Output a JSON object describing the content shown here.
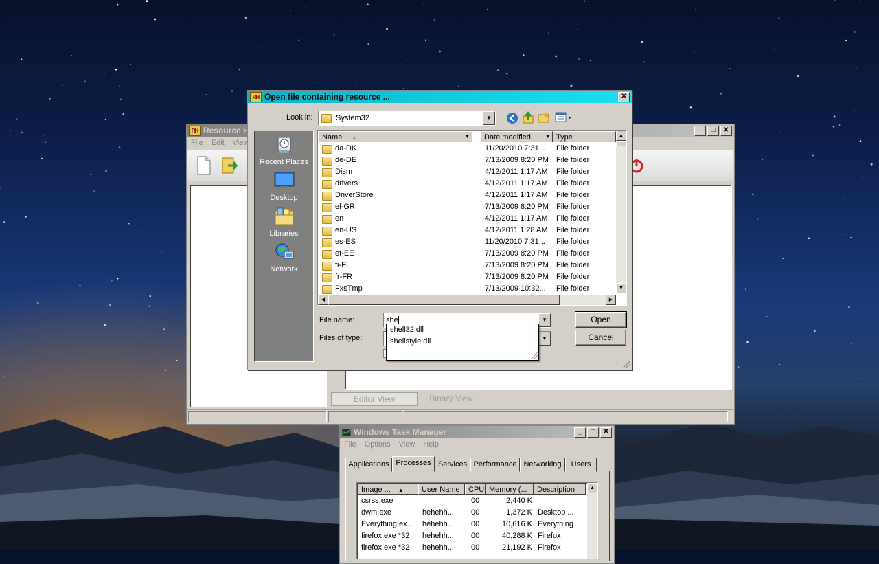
{
  "colors": {
    "accent_title": "#19e0f0",
    "folder": "#e4b93e",
    "inactive_title": "#a0a0a0"
  },
  "resource_hacker": {
    "title": "Resource H",
    "menu": [
      "File",
      "Edit",
      "View"
    ],
    "tabs": {
      "editor": "Editor View",
      "binary": "Binary View"
    }
  },
  "dialog": {
    "title": "Open file containing resource ...",
    "look_in_label": "Look in:",
    "look_in_value": "System32",
    "places": [
      {
        "label": "Recent Places",
        "icon": "recent-places-icon"
      },
      {
        "label": "Desktop",
        "icon": "desktop-icon"
      },
      {
        "label": "Libraries",
        "icon": "libraries-icon"
      },
      {
        "label": "Network",
        "icon": "network-icon"
      }
    ],
    "columns": {
      "name": "Name",
      "date": "Date modified",
      "type": "Type"
    },
    "files": [
      {
        "name": "da-DK",
        "date": "11/20/2010 7:31...",
        "type": "File folder"
      },
      {
        "name": "de-DE",
        "date": "7/13/2009 8:20 PM",
        "type": "File folder"
      },
      {
        "name": "Dism",
        "date": "4/12/2011 1:17 AM",
        "type": "File folder"
      },
      {
        "name": "drivers",
        "date": "4/12/2011 1:17 AM",
        "type": "File folder"
      },
      {
        "name": "DriverStore",
        "date": "4/12/2011 1:17 AM",
        "type": "File folder"
      },
      {
        "name": "el-GR",
        "date": "7/13/2009 8:20 PM",
        "type": "File folder"
      },
      {
        "name": "en",
        "date": "4/12/2011 1:17 AM",
        "type": "File folder"
      },
      {
        "name": "en-US",
        "date": "4/12/2011 1:28 AM",
        "type": "File folder"
      },
      {
        "name": "es-ES",
        "date": "11/20/2010 7:31...",
        "type": "File folder"
      },
      {
        "name": "et-EE",
        "date": "7/13/2009 8:20 PM",
        "type": "File folder"
      },
      {
        "name": "fi-FI",
        "date": "7/13/2009 8:20 PM",
        "type": "File folder"
      },
      {
        "name": "fr-FR",
        "date": "7/13/2009 8:20 PM",
        "type": "File folder"
      },
      {
        "name": "FxsTmp",
        "date": "7/13/2009 10:32...",
        "type": "File folder"
      }
    ],
    "file_name_label": "File name:",
    "file_name_value": "she",
    "files_of_type_label": "Files of type:",
    "suggestions": [
      "shell32.dll",
      "shellstyle.dll"
    ],
    "open_button": "Open",
    "cancel_button": "Cancel"
  },
  "task_manager": {
    "title": "Windows Task Manager",
    "menu": [
      "File",
      "Options",
      "View",
      "Help"
    ],
    "tabs": [
      "Applications",
      "Processes",
      "Services",
      "Performance",
      "Networking",
      "Users"
    ],
    "selected_tab": "Processes",
    "columns": [
      "Image ...",
      "User Name",
      "CPU",
      "Memory (...",
      "Description"
    ],
    "rows": [
      {
        "image": "csrss.exe",
        "user": "",
        "cpu": "00",
        "mem": "2,440 K",
        "desc": ""
      },
      {
        "image": "dwm.exe",
        "user": "hehehh...",
        "cpu": "00",
        "mem": "1,372 K",
        "desc": "Desktop ..."
      },
      {
        "image": "Everything.ex...",
        "user": "hehehh...",
        "cpu": "00",
        "mem": "10,616 K",
        "desc": "Everything"
      },
      {
        "image": "firefox.exe *32",
        "user": "hehehh...",
        "cpu": "00",
        "mem": "40,288 K",
        "desc": "Firefox"
      },
      {
        "image": "firefox.exe *32",
        "user": "hehehh...",
        "cpu": "00",
        "mem": "21,192 K",
        "desc": "Firefox"
      }
    ]
  }
}
